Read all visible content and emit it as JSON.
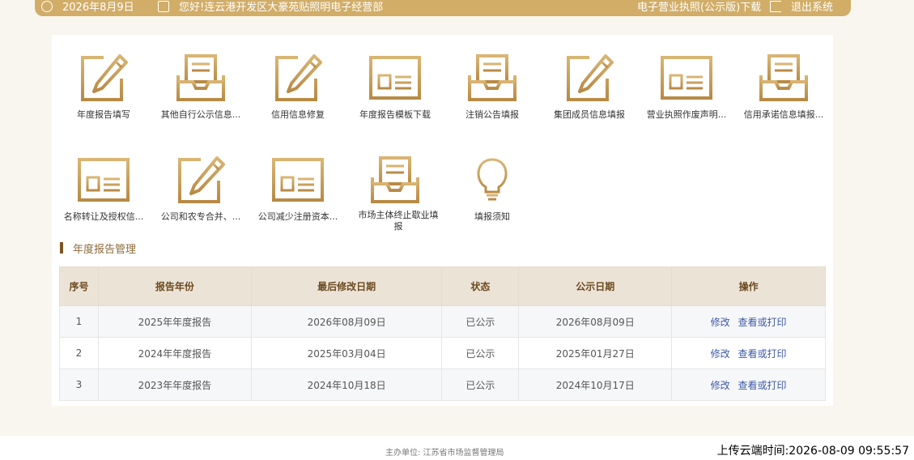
{
  "topbar": {
    "date": "2026年8月9日",
    "greeting": "您好!连云港开发区大豪苑贴照明电子经营部",
    "license_download": "电子营业执照(公示版)下载",
    "logout": "退出系统"
  },
  "tiles": [
    {
      "label": "年度报告填写",
      "icon": "pen-icon"
    },
    {
      "label": "其他自行公示信息...",
      "icon": "tray-icon"
    },
    {
      "label": "信用信息修复",
      "icon": "pen-icon"
    },
    {
      "label": "年度报告模板下载",
      "icon": "window-icon"
    },
    {
      "label": "注销公告填报",
      "icon": "tray-icon"
    },
    {
      "label": "集团成员信息填报",
      "icon": "pen-icon"
    },
    {
      "label": "营业执照作废声明...",
      "icon": "window-icon"
    },
    {
      "label": "信用承诺信息填报...",
      "icon": "tray-icon"
    },
    {
      "label": "名称转让及授权信...",
      "icon": "window-icon"
    },
    {
      "label": "公司和农专合并、...",
      "icon": "pen-icon"
    },
    {
      "label": "公司减少注册资本...",
      "icon": "window-icon"
    },
    {
      "label": "市场主体终止歇业填报",
      "icon": "tray-icon"
    },
    {
      "label": "填报须知",
      "icon": "lightbulb-icon"
    }
  ],
  "section_title": "年度报告管理",
  "table": {
    "headers": [
      "序号",
      "报告年份",
      "最后修改日期",
      "状态",
      "公示日期",
      "操作"
    ],
    "rows": [
      {
        "no": "1",
        "year": "2025年年度报告",
        "modified": "2026年08月09日",
        "status": "已公示",
        "publish": "2026年08月09日",
        "edit": "修改",
        "view": "查看或打印"
      },
      {
        "no": "2",
        "year": "2024年年度报告",
        "modified": "2025年03月04日",
        "status": "已公示",
        "publish": "2025年01月27日",
        "edit": "修改",
        "view": "查看或打印"
      },
      {
        "no": "3",
        "year": "2023年年度报告",
        "modified": "2024年10月18日",
        "status": "已公示",
        "publish": "2024年10月17日",
        "edit": "修改",
        "view": "查看或打印"
      }
    ]
  },
  "footer": {
    "sponsor": "主办单位:  江苏省市场监督管理局",
    "upload_time": "上传云端时间:2026-08-09 09:55:57"
  },
  "colors": {
    "gold": "#c8a160",
    "banner": "#d1ad68",
    "header_bg": "#ece3d7",
    "link": "#3d5aa8"
  }
}
